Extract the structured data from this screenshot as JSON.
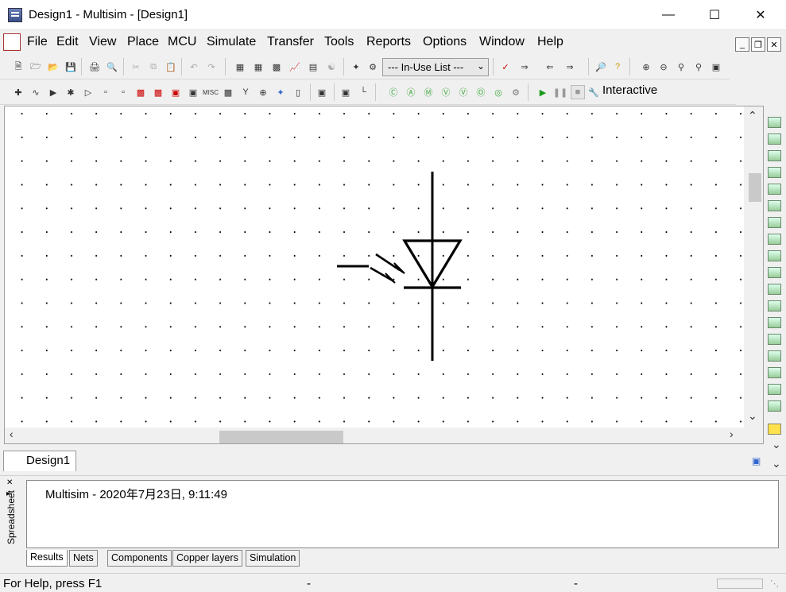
{
  "window": {
    "title": "Design1 - Multisim - [Design1]"
  },
  "menu": [
    "File",
    "Edit",
    "View",
    "Place",
    "MCU",
    "Simulate",
    "Transfer",
    "Tools",
    "Reports",
    "Options",
    "Window",
    "Help"
  ],
  "toolbar": {
    "inuse_list": "--- In-Use List ---",
    "interactive_label": "Interactive"
  },
  "design_tab": {
    "label": "Design1"
  },
  "spreadsheet": {
    "side_label": "Spreadsheet",
    "results_line": "Multisim  -  2020年7月23日, 9:11:49",
    "tabs": [
      "Results",
      "Nets",
      "Components",
      "Copper layers",
      "Simulation"
    ]
  },
  "status": {
    "help_text": "For Help, press F1",
    "field2": "-",
    "field3": "-"
  }
}
